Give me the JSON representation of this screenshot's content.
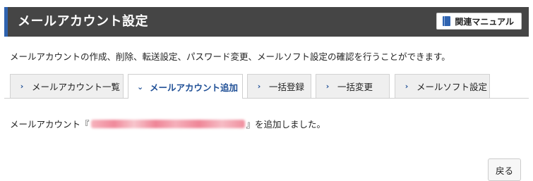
{
  "header": {
    "title": "メールアカウント設定",
    "manual_label": "関連マニュアル",
    "manual_icon": "book-icon",
    "accent_color": "#2f63b0"
  },
  "description": "メールアカウントの作成、削除、転送設定、パスワード変更、メールソフト設定の確認を行うことができます。",
  "tabs": [
    {
      "label": "メールアカウント一覧",
      "icon": "chevron-right-icon",
      "active": false
    },
    {
      "label": "メールアカウント追加",
      "icon": "chevron-down-icon",
      "active": true
    },
    {
      "label": "一括登録",
      "icon": "chevron-right-icon",
      "active": false
    },
    {
      "label": "一括変更",
      "icon": "chevron-right-icon",
      "active": false
    },
    {
      "label": "メールソフト設定",
      "icon": "chevron-right-icon",
      "active": false
    }
  ],
  "result": {
    "prefix": "メールアカウント『",
    "suffix": "』を追加しました。"
  },
  "back_button_label": "戻る"
}
